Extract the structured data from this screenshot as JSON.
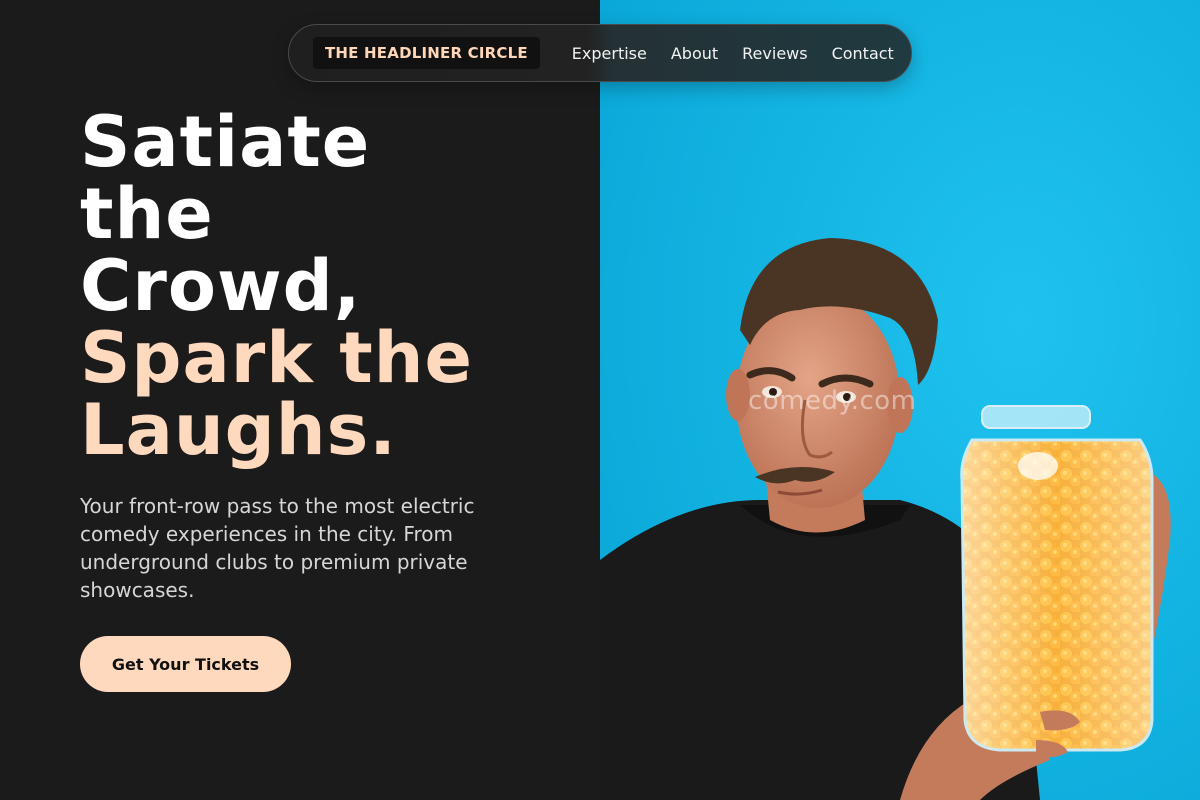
{
  "nav": {
    "brand": "THE HEADLINER CIRCLE",
    "links": [
      {
        "label": "Expertise"
      },
      {
        "label": "About"
      },
      {
        "label": "Reviews"
      },
      {
        "label": "Contact"
      }
    ]
  },
  "hero": {
    "headline_white": [
      "Satiate",
      "the",
      "Crowd,"
    ],
    "headline_accent": [
      "Spark the",
      "Laughs."
    ],
    "subtitle": "Your front-row pass to the most electric comedy experiences in the city. From underground clubs to premium private showcases.",
    "cta_label": "Get Your Tickets"
  },
  "image": {
    "watermark": "comedy.com",
    "description": "man with mustache holding a large jar of cheese puffs against blue background"
  },
  "colors": {
    "accent": "#ffd9bd",
    "dark_bg": "#1c1b1c",
    "photo_bg": "#0db4e4"
  }
}
